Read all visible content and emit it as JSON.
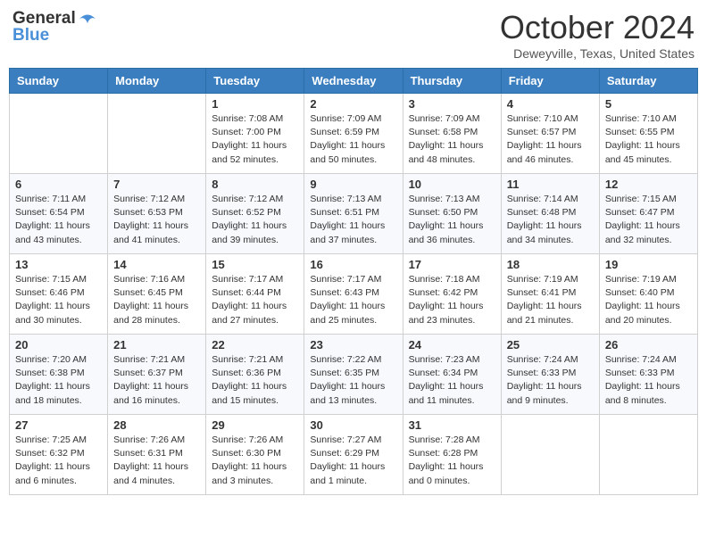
{
  "header": {
    "logo_line1": "General",
    "logo_line2": "Blue",
    "month_title": "October 2024",
    "location": "Deweyville, Texas, United States"
  },
  "days_of_week": [
    "Sunday",
    "Monday",
    "Tuesday",
    "Wednesday",
    "Thursday",
    "Friday",
    "Saturday"
  ],
  "weeks": [
    [
      null,
      null,
      {
        "day": 1,
        "sunrise": "Sunrise: 7:08 AM",
        "sunset": "Sunset: 7:00 PM",
        "daylight": "Daylight: 11 hours and 52 minutes."
      },
      {
        "day": 2,
        "sunrise": "Sunrise: 7:09 AM",
        "sunset": "Sunset: 6:59 PM",
        "daylight": "Daylight: 11 hours and 50 minutes."
      },
      {
        "day": 3,
        "sunrise": "Sunrise: 7:09 AM",
        "sunset": "Sunset: 6:58 PM",
        "daylight": "Daylight: 11 hours and 48 minutes."
      },
      {
        "day": 4,
        "sunrise": "Sunrise: 7:10 AM",
        "sunset": "Sunset: 6:57 PM",
        "daylight": "Daylight: 11 hours and 46 minutes."
      },
      {
        "day": 5,
        "sunrise": "Sunrise: 7:10 AM",
        "sunset": "Sunset: 6:55 PM",
        "daylight": "Daylight: 11 hours and 45 minutes."
      }
    ],
    [
      {
        "day": 6,
        "sunrise": "Sunrise: 7:11 AM",
        "sunset": "Sunset: 6:54 PM",
        "daylight": "Daylight: 11 hours and 43 minutes."
      },
      {
        "day": 7,
        "sunrise": "Sunrise: 7:12 AM",
        "sunset": "Sunset: 6:53 PM",
        "daylight": "Daylight: 11 hours and 41 minutes."
      },
      {
        "day": 8,
        "sunrise": "Sunrise: 7:12 AM",
        "sunset": "Sunset: 6:52 PM",
        "daylight": "Daylight: 11 hours and 39 minutes."
      },
      {
        "day": 9,
        "sunrise": "Sunrise: 7:13 AM",
        "sunset": "Sunset: 6:51 PM",
        "daylight": "Daylight: 11 hours and 37 minutes."
      },
      {
        "day": 10,
        "sunrise": "Sunrise: 7:13 AM",
        "sunset": "Sunset: 6:50 PM",
        "daylight": "Daylight: 11 hours and 36 minutes."
      },
      {
        "day": 11,
        "sunrise": "Sunrise: 7:14 AM",
        "sunset": "Sunset: 6:48 PM",
        "daylight": "Daylight: 11 hours and 34 minutes."
      },
      {
        "day": 12,
        "sunrise": "Sunrise: 7:15 AM",
        "sunset": "Sunset: 6:47 PM",
        "daylight": "Daylight: 11 hours and 32 minutes."
      }
    ],
    [
      {
        "day": 13,
        "sunrise": "Sunrise: 7:15 AM",
        "sunset": "Sunset: 6:46 PM",
        "daylight": "Daylight: 11 hours and 30 minutes."
      },
      {
        "day": 14,
        "sunrise": "Sunrise: 7:16 AM",
        "sunset": "Sunset: 6:45 PM",
        "daylight": "Daylight: 11 hours and 28 minutes."
      },
      {
        "day": 15,
        "sunrise": "Sunrise: 7:17 AM",
        "sunset": "Sunset: 6:44 PM",
        "daylight": "Daylight: 11 hours and 27 minutes."
      },
      {
        "day": 16,
        "sunrise": "Sunrise: 7:17 AM",
        "sunset": "Sunset: 6:43 PM",
        "daylight": "Daylight: 11 hours and 25 minutes."
      },
      {
        "day": 17,
        "sunrise": "Sunrise: 7:18 AM",
        "sunset": "Sunset: 6:42 PM",
        "daylight": "Daylight: 11 hours and 23 minutes."
      },
      {
        "day": 18,
        "sunrise": "Sunrise: 7:19 AM",
        "sunset": "Sunset: 6:41 PM",
        "daylight": "Daylight: 11 hours and 21 minutes."
      },
      {
        "day": 19,
        "sunrise": "Sunrise: 7:19 AM",
        "sunset": "Sunset: 6:40 PM",
        "daylight": "Daylight: 11 hours and 20 minutes."
      }
    ],
    [
      {
        "day": 20,
        "sunrise": "Sunrise: 7:20 AM",
        "sunset": "Sunset: 6:38 PM",
        "daylight": "Daylight: 11 hours and 18 minutes."
      },
      {
        "day": 21,
        "sunrise": "Sunrise: 7:21 AM",
        "sunset": "Sunset: 6:37 PM",
        "daylight": "Daylight: 11 hours and 16 minutes."
      },
      {
        "day": 22,
        "sunrise": "Sunrise: 7:21 AM",
        "sunset": "Sunset: 6:36 PM",
        "daylight": "Daylight: 11 hours and 15 minutes."
      },
      {
        "day": 23,
        "sunrise": "Sunrise: 7:22 AM",
        "sunset": "Sunset: 6:35 PM",
        "daylight": "Daylight: 11 hours and 13 minutes."
      },
      {
        "day": 24,
        "sunrise": "Sunrise: 7:23 AM",
        "sunset": "Sunset: 6:34 PM",
        "daylight": "Daylight: 11 hours and 11 minutes."
      },
      {
        "day": 25,
        "sunrise": "Sunrise: 7:24 AM",
        "sunset": "Sunset: 6:33 PM",
        "daylight": "Daylight: 11 hours and 9 minutes."
      },
      {
        "day": 26,
        "sunrise": "Sunrise: 7:24 AM",
        "sunset": "Sunset: 6:33 PM",
        "daylight": "Daylight: 11 hours and 8 minutes."
      }
    ],
    [
      {
        "day": 27,
        "sunrise": "Sunrise: 7:25 AM",
        "sunset": "Sunset: 6:32 PM",
        "daylight": "Daylight: 11 hours and 6 minutes."
      },
      {
        "day": 28,
        "sunrise": "Sunrise: 7:26 AM",
        "sunset": "Sunset: 6:31 PM",
        "daylight": "Daylight: 11 hours and 4 minutes."
      },
      {
        "day": 29,
        "sunrise": "Sunrise: 7:26 AM",
        "sunset": "Sunset: 6:30 PM",
        "daylight": "Daylight: 11 hours and 3 minutes."
      },
      {
        "day": 30,
        "sunrise": "Sunrise: 7:27 AM",
        "sunset": "Sunset: 6:29 PM",
        "daylight": "Daylight: 11 hours and 1 minute."
      },
      {
        "day": 31,
        "sunrise": "Sunrise: 7:28 AM",
        "sunset": "Sunset: 6:28 PM",
        "daylight": "Daylight: 11 hours and 0 minutes."
      },
      null,
      null
    ]
  ]
}
